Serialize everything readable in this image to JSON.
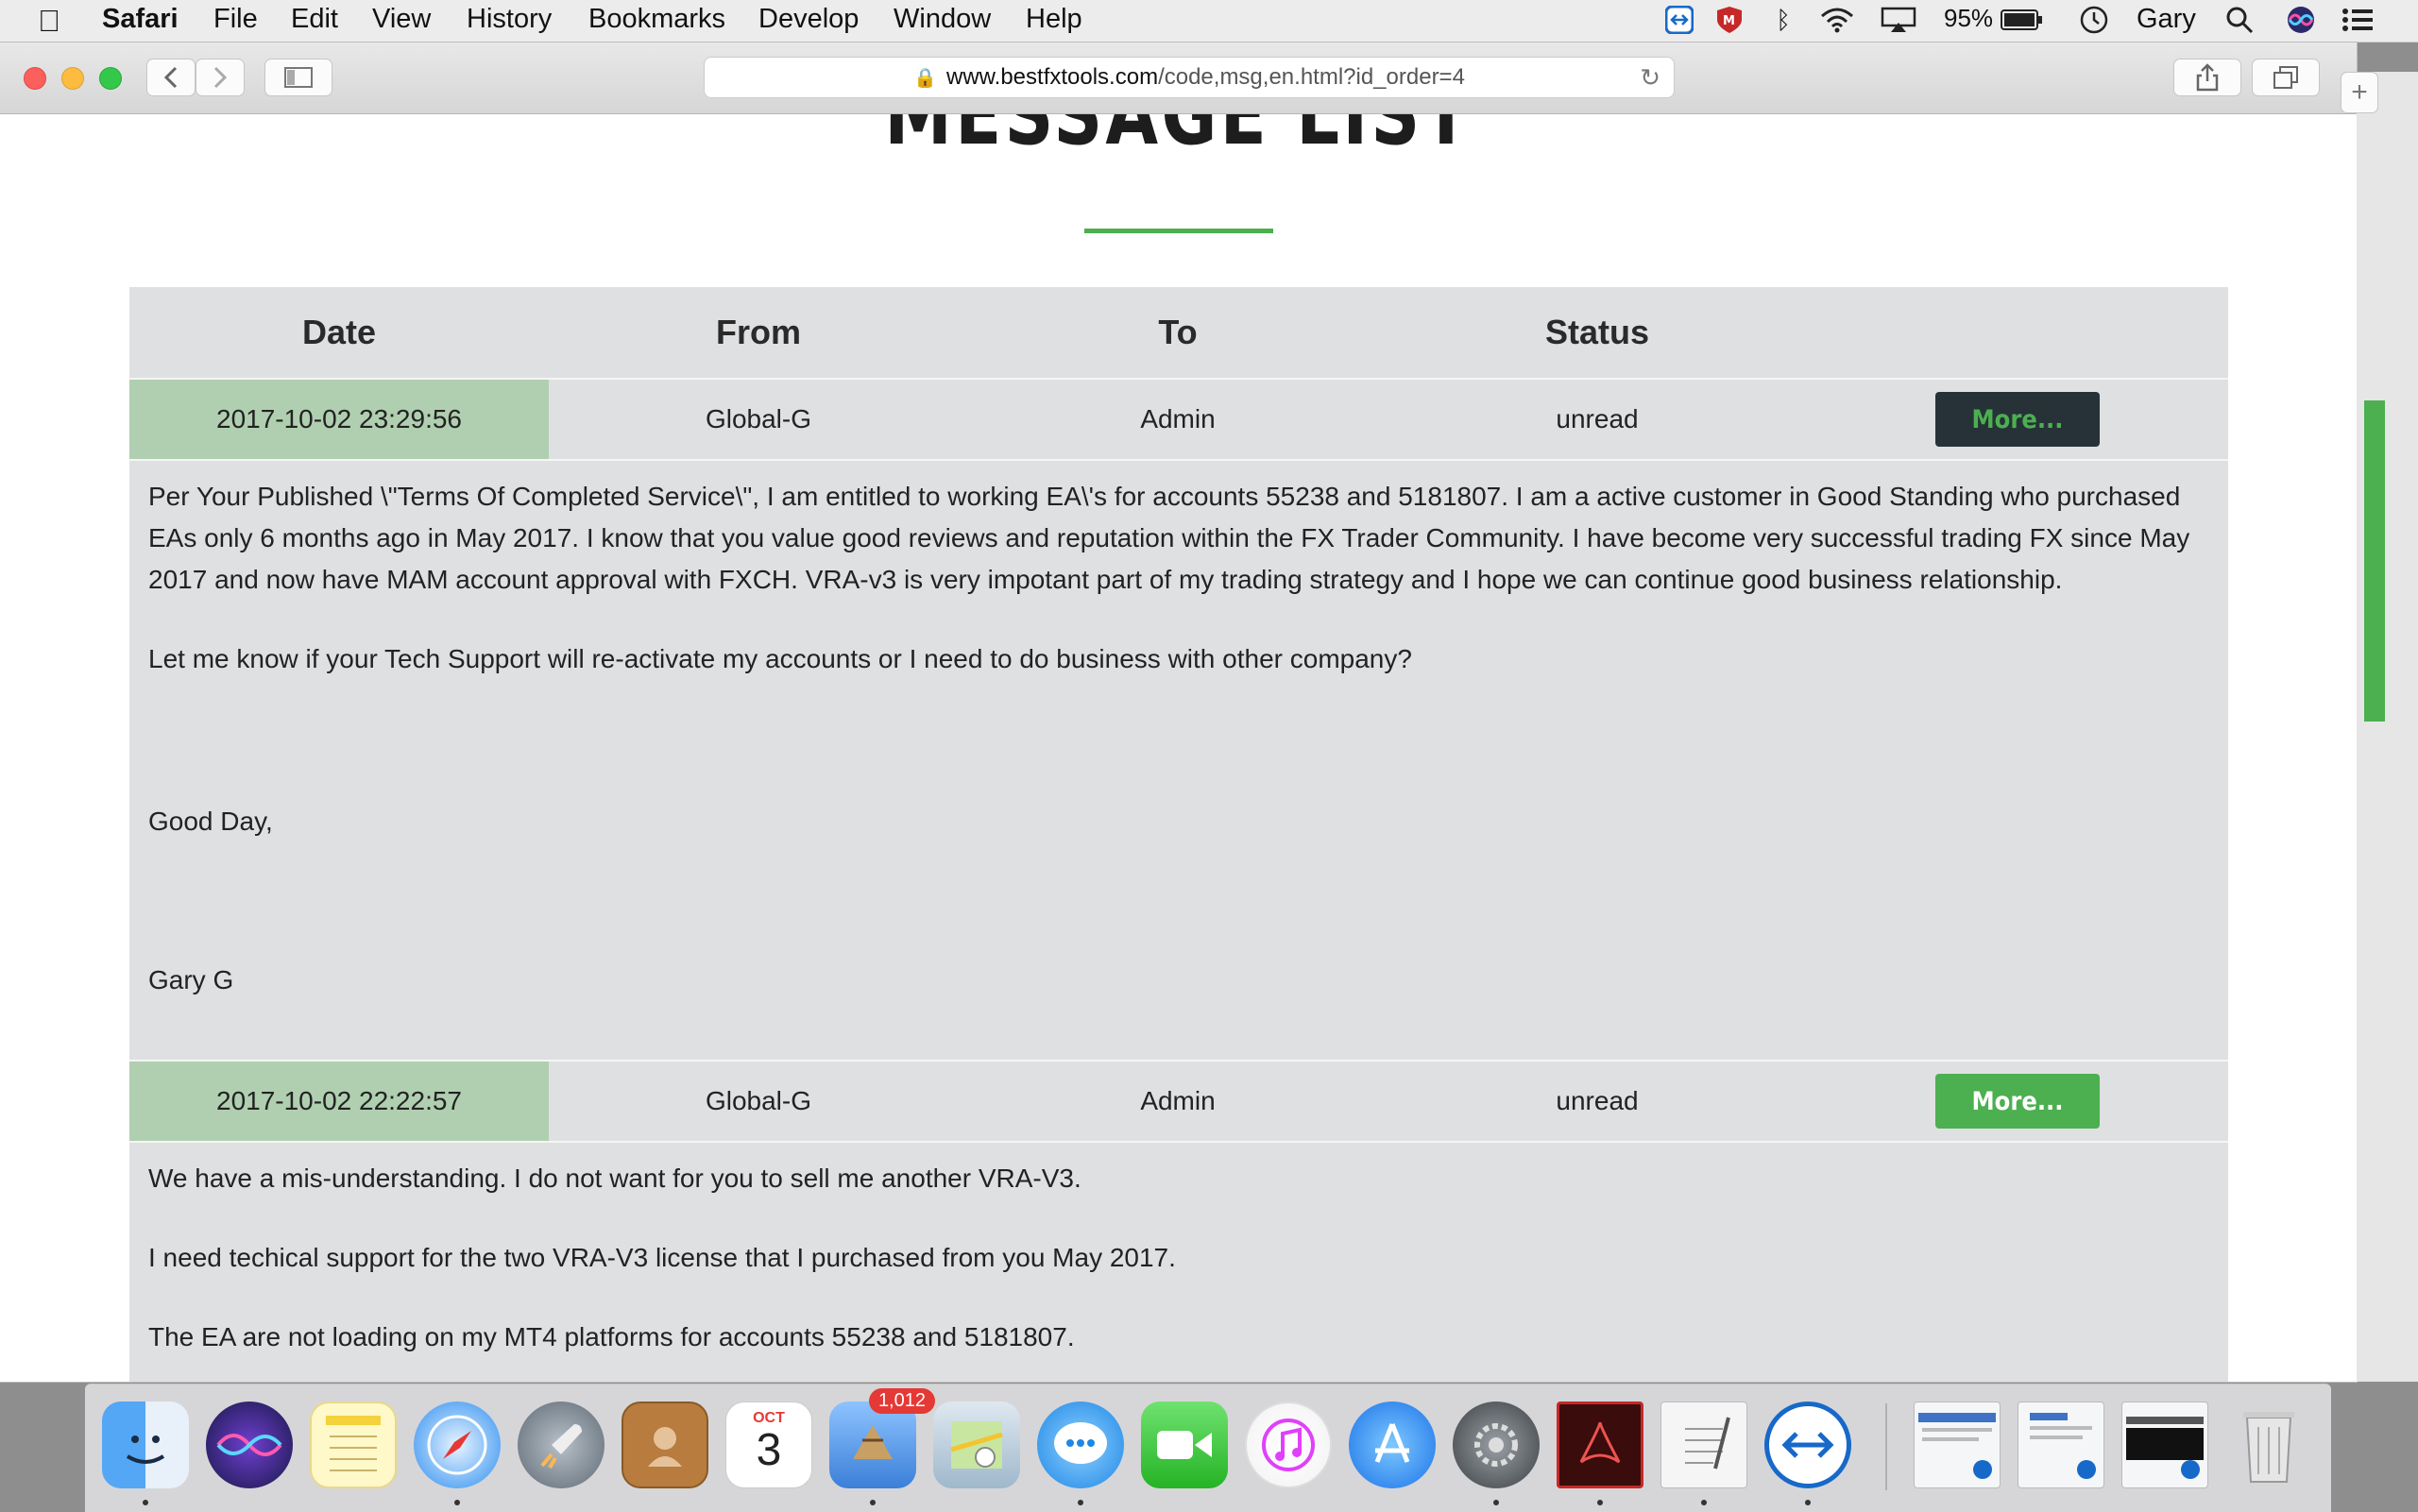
{
  "menubar": {
    "app_name": "Safari",
    "items": [
      "File",
      "Edit",
      "View",
      "History",
      "Bookmarks",
      "Develop",
      "Window",
      "Help"
    ],
    "battery": "95%",
    "user": "Gary"
  },
  "browser": {
    "url_host": "www.bestfxtools.com",
    "url_path": "/code,msg,en.html?id_order=4"
  },
  "page": {
    "title": "MESSAGE LIST",
    "columns": [
      "Date",
      "From",
      "To",
      "Status"
    ],
    "messages": [
      {
        "date": "2017-10-02 23:29:56",
        "from": "Global-G",
        "to": "Admin",
        "status": "unread",
        "button": "More...",
        "body": [
          "Per Your Published \\\"Terms Of Completed Service\\\", I am entitled to working EA\\'s for accounts 55238 and 5181807.  I am a active customer in Good Standing who purchased EAs only 6 months ago in May 2017.  I know that you value good reviews and reputation within the FX Trader Community. I have become very successful trading FX since May 2017 and now have MAM account approval with FXCH.  VRA-v3 is very impotant part of my trading strategy and I hope we can continue good business relationship.",
          "Let me know if your Tech Support will re-activate my accounts or I need to do business with other company?",
          "Good Day,",
          "Gary G"
        ]
      },
      {
        "date": "2017-10-02 22:22:57",
        "from": "Global-G",
        "to": "Admin",
        "status": "unread",
        "button": "More...",
        "body": [
          "We have a mis-understanding.  I do not want for you to sell me another VRA-V3.",
          "I need techical support for the two VRA-V3 license that I purchased from you May 2017.",
          "The EA are not loading on my MT4 platforms for accounts 55238 and 5181807."
        ]
      }
    ]
  },
  "dock": {
    "calendar_month": "OCT",
    "calendar_day": "3",
    "mail_badge": "1,012"
  },
  "colors": {
    "accent_green": "#4caf50",
    "dark_button": "#263238",
    "date_cell": "#b0cfb0",
    "table_bg": "#dfe0e2"
  }
}
